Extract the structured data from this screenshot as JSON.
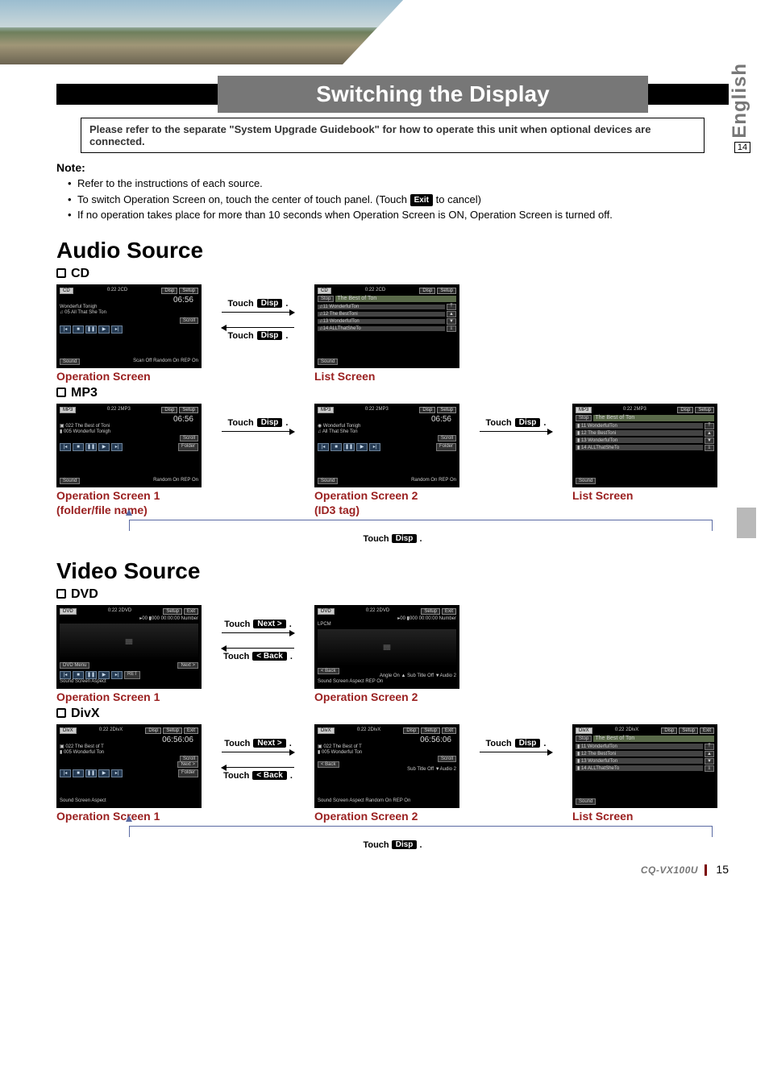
{
  "side": {
    "language": "English",
    "page_small": "14"
  },
  "title": "Switching the Display",
  "intro_box": "Please refer to the separate \"System Upgrade Guidebook\" for how to operate this unit when optional devices are connected.",
  "note_heading": "Note:",
  "notes": {
    "n1": "Refer to the instructions of each source.",
    "n2a": "To switch Operation Screen on, touch the center of touch panel. (Touch ",
    "n2_btn": "Exit",
    "n2b": " to cancel)",
    "n3": "If no operation takes place for more than 10 seconds when Operation Screen is ON, Operation Screen is turned off."
  },
  "sections": {
    "audio": "Audio Source",
    "video": "Video Source"
  },
  "subs": {
    "cd": "CD",
    "mp3": "MP3",
    "dvd": "DVD",
    "divx": "DivX"
  },
  "touch": {
    "disp": "Disp",
    "next": "Next >",
    "back": "< Back",
    "label": "Touch",
    "period": "."
  },
  "captions": {
    "op": "Operation Screen",
    "op1": "Operation Screen 1",
    "op2": "Operation Screen 2",
    "list": "List Screen",
    "mp3_op1_sub": "(folder/file name)",
    "mp3_op2_sub": "(ID3 tag)"
  },
  "shots": {
    "cd_op": {
      "hdr_l": "CD",
      "hdr_m": "0:22  2CD",
      "hdr_r1": "Disp",
      "hdr_r2": "Setup",
      "time": "06:56",
      "line1": "   Wonderful Tonigh",
      "line2": "♫ 05 All That She Ton",
      "scroll": "Scroll",
      "bottom_l": "Sound",
      "bottom_opts": "Scan  Off  Random On  REP On"
    },
    "cd_list": {
      "hdr_l": "CD",
      "hdr_m": "0:22  2CD",
      "hdr_r1": "Disp",
      "hdr_r2": "Setup",
      "stop": "Stop",
      "title": "The Best of Ton",
      "rows": [
        "♫11 WonderfulTon",
        "♫12 The BestToni",
        "♫13 WonderfulTon",
        "♫14 ALLThatSheTo"
      ],
      "arrows": [
        "⤒",
        "▲",
        "▼",
        "⤓"
      ],
      "bottom_l": "Sound"
    },
    "mp3_op1": {
      "hdr_l": "MP3",
      "hdr_m": "0:22  2MP3",
      "hdr_r1": "Disp",
      "hdr_r2": "Setup",
      "time": "06:56",
      "line1": "▣ 022 The Best of Toni",
      "line2": "▮ 005 Wonderful Tonigh",
      "scroll": "Scroll",
      "folder": "Folder",
      "bottom_l": "Sound",
      "bottom_opts": "Random On  REP On"
    },
    "mp3_op2": {
      "hdr_l": "MP3",
      "hdr_m": "0:22  2MP3",
      "hdr_r1": "Disp",
      "hdr_r2": "Setup",
      "time": "06:56",
      "line1": "◉ Wonderful Tonigh",
      "line2": "♫ All That She Ton",
      "scroll": "Scroll",
      "folder": "Folder",
      "bottom_l": "Sound",
      "bottom_opts": "Random On  REP On"
    },
    "mp3_list": {
      "hdr_l": "MP3",
      "hdr_m": "0:22  2MP3",
      "hdr_r1": "Disp",
      "hdr_r2": "Setup",
      "stop": "Stop",
      "title": "The Best of Ton",
      "rows": [
        "▮ 11 WonderfulTon",
        "▮ 12 The BestToni",
        "▮ 13 WonderfulTon",
        "▮ 14 ALLThatSheTo"
      ],
      "arrows": [
        "⤒",
        "▲",
        "▼",
        "⤓"
      ],
      "bottom_l": "Sound"
    },
    "dvd_op1": {
      "hdr_l": "DVD",
      "hdr_m": "0:22  2DVD",
      "hdr_r1": "Setup",
      "hdr_r2": "Exit",
      "info": "▸00  ▮000 00:00:00  Number",
      "menu": "DVD Menu",
      "next": "Next >",
      "ret": "RET",
      "bottom": "Sound   Screen   Aspect"
    },
    "dvd_op2": {
      "hdr_l": "DVD",
      "hdr_m": "0:22  2DVD",
      "hdr_r1": "Setup",
      "hdr_r2": "Exit",
      "info": "▸00  ▮000 00:00:00  Number",
      "lpcm": "LPCM",
      "back": "< Back",
      "opts": "Angle  On ▲ Sub Title  Off ▼Audio 2",
      "bottom": "Sound   Screen   Aspect           REP On"
    },
    "divx_op1": {
      "hdr_l": "DivX",
      "hdr_m": "0:22  2DivX",
      "hdr_r1": "Disp",
      "hdr_r2": "Setup",
      "hdr_r3": "Exit",
      "time": "06:56:06",
      "line1": "▣ 022 The Best of T",
      "line2": "▮ 005 Wonderful Ton",
      "scroll": "Scroll",
      "next": "Next >",
      "folder": "Folder",
      "bottom": "Sound   Screen   Aspect"
    },
    "divx_op2": {
      "hdr_l": "DivX",
      "hdr_m": "0:22  2DivX",
      "hdr_r1": "Disp",
      "hdr_r2": "Setup",
      "hdr_r3": "Exit",
      "time": "06:56:06",
      "line1": "▣ 022 The Best of T",
      "line2": "▮ 005 Wonderful Ton",
      "scroll": "Scroll",
      "back": "< Back",
      "opts": "Sub Title  Off ▼Audio 2",
      "bottom": "Sound   Screen   Aspect  Random On  REP On"
    },
    "divx_list": {
      "hdr_l": "DivX",
      "hdr_m": "0:22  2DivX",
      "hdr_r1": "Disp",
      "hdr_r2": "Setup",
      "hdr_r3": "Exit",
      "stop": "Stop",
      "title": "The Best of Ton",
      "rows": [
        "▮ 11 WonderfulTon",
        "▮ 12 The BestToni",
        "▮ 13 WonderfulTon",
        "▮ 14 ALLThatSheTo"
      ],
      "arrows": [
        "⤒",
        "▲",
        "▼",
        "⤓"
      ],
      "bottom_l": "Sound"
    }
  },
  "footer": {
    "model": "CQ-VX100U",
    "page": "15"
  }
}
